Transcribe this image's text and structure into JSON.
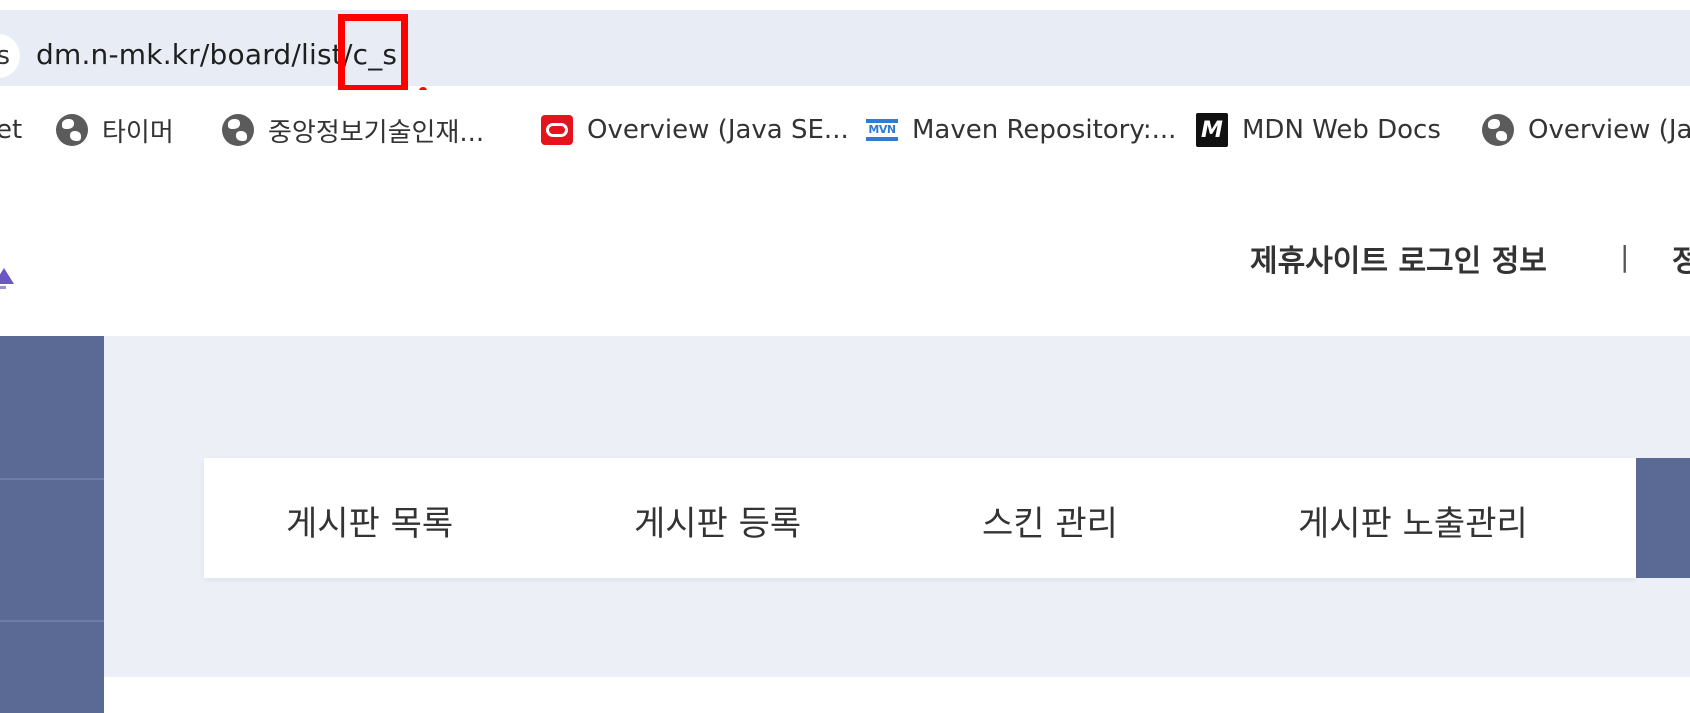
{
  "browser": {
    "site_icon_glyph": "s",
    "url": "dm.n-mk.kr/board/list/c_s",
    "highlight_color": "#ff0000"
  },
  "bookmarks": [
    {
      "label": "et",
      "icon": "none"
    },
    {
      "label": "타이머",
      "icon": "globe-icon"
    },
    {
      "label": "중앙정보기술인재...",
      "icon": "globe-icon"
    },
    {
      "label": "Overview (Java SE...",
      "icon": "oracle-icon"
    },
    {
      "label": "Maven Repository:...",
      "icon": "maven-icon",
      "icon_text": "MVN"
    },
    {
      "label": "MDN Web Docs",
      "icon": "mdn-icon",
      "icon_text": "M"
    },
    {
      "label": "Overview (Jak",
      "icon": "globe-icon"
    }
  ],
  "header": {
    "partner_login_label": "제휴사이트 로그인 정보",
    "separator": "|",
    "cut_link_label": "정"
  },
  "board_tabs": [
    {
      "label": "게시판 목록"
    },
    {
      "label": "게시판 등록"
    },
    {
      "label": "스킨 관리"
    },
    {
      "label": "게시판 노출관리"
    }
  ],
  "colors": {
    "sidebar": "#5a6a94",
    "content_bg": "#ecf0f6",
    "omnibox_bg": "#e8edf5"
  }
}
